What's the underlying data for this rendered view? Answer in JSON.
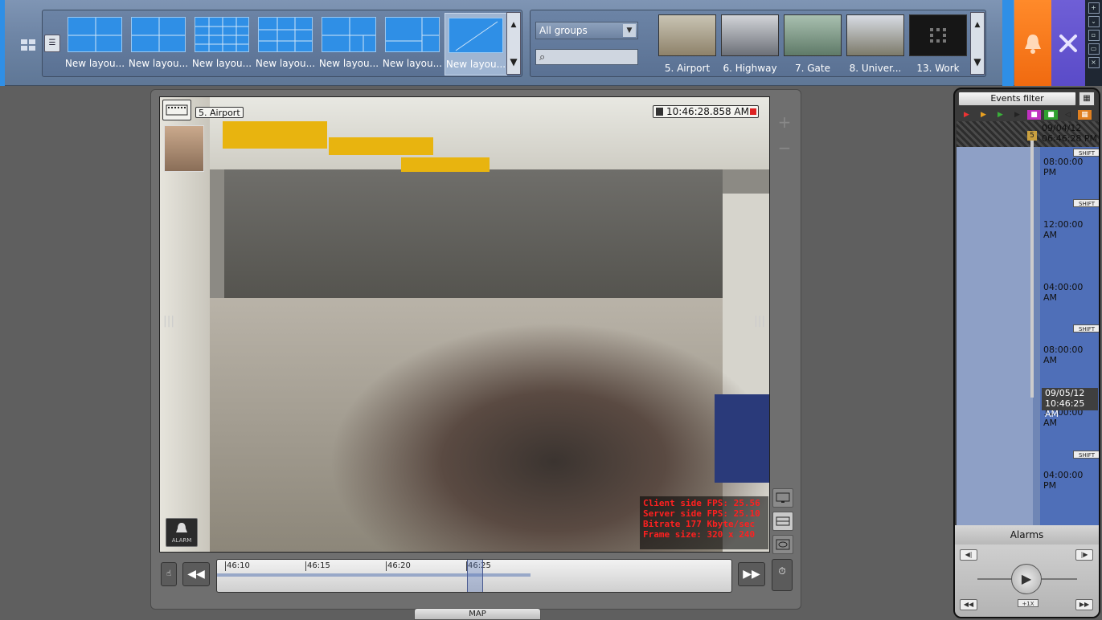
{
  "toolbar": {
    "layouts": [
      {
        "label": "New layou...",
        "grid": "2x2-wide"
      },
      {
        "label": "New layou...",
        "grid": "2x2"
      },
      {
        "label": "New layou...",
        "grid": "4x4"
      },
      {
        "label": "New layou...",
        "grid": "3x3"
      },
      {
        "label": "New layou...",
        "grid": "3-big"
      },
      {
        "label": "New layou...",
        "grid": "1-big-3"
      },
      {
        "label": "New layou...",
        "grid": "1x1"
      }
    ],
    "selected_layout_index": 6,
    "group_select": "All groups",
    "search_value": "",
    "cameras": [
      {
        "label": "5. Airport",
        "thumb_color": "#9a8d72"
      },
      {
        "label": "6. Highway",
        "thumb_color": "#7c8088"
      },
      {
        "label": "7. Gate",
        "thumb_color": "#7d9486"
      },
      {
        "label": "8. Univer...",
        "thumb_color": "#8a8c7c"
      },
      {
        "label": "13. Work",
        "thumb_color": "#1a1a1a"
      }
    ],
    "accent_orange": "#f47a1e",
    "accent_purple": "#6452d0",
    "accent_blue": "#2f8fe6"
  },
  "viewer": {
    "camera_title": "5. Airport",
    "timestamp": "10:46:28.858 AM",
    "stats": [
      "Client side FPS: 25.56",
      "Server side FPS: 25.10",
      "Bitrate 177 Kbyte/sec",
      "Frame size: 320 x 240"
    ],
    "alarm_label": "ALARM",
    "timeline_ticks": [
      "46:10",
      "46:15",
      "46:20",
      "46:25"
    ],
    "map_tab": "MAP"
  },
  "events": {
    "filter_label": "Events filter",
    "start_date": "09/04/12",
    "start_time": "06:46:28 PM",
    "times": [
      "08:00:00 PM",
      "12:00:00 AM",
      "04:00:00 AM",
      "08:00:00 AM",
      "12:00:00 AM",
      "04:00:00 PM"
    ],
    "shift_label": "SHIFT",
    "current_date": "09/05/12",
    "current_time": "10:46:25 AM",
    "alarms_label": "Alarms",
    "speed": "+1X"
  }
}
